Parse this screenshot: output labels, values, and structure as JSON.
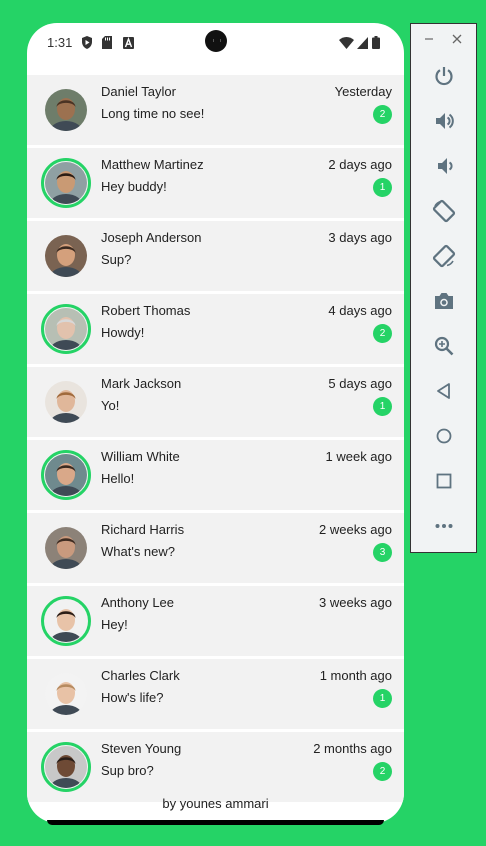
{
  "status_bar": {
    "time": "1:31"
  },
  "chats": [
    {
      "name": "Daniel Taylor",
      "message": "Long time no see!",
      "time": "Yesterday",
      "unread": "2",
      "online": false,
      "skin": "#9c7150",
      "hair": "#4a3324",
      "bg": "#6e7d6a"
    },
    {
      "name": "Matthew Martinez",
      "message": "Hey buddy!",
      "time": "2 days ago",
      "unread": "1",
      "online": true,
      "skin": "#c99a74",
      "hair": "#2c1d14",
      "bg": "#8fa0a3"
    },
    {
      "name": "Joseph Anderson",
      "message": "Sup?",
      "time": "3 days ago",
      "unread": "",
      "online": false,
      "skin": "#d4a07c",
      "hair": "#3b2a20",
      "bg": "#7a6352"
    },
    {
      "name": "Robert Thomas",
      "message": "Howdy!",
      "time": "4 days ago",
      "unread": "2",
      "online": true,
      "skin": "#e2c2ad",
      "hair": "#d8d8d8",
      "bg": "#b7bfb4"
    },
    {
      "name": "Mark Jackson",
      "message": "Yo!",
      "time": "5 days ago",
      "unread": "1",
      "online": false,
      "skin": "#e0b79a",
      "hair": "#a06a3c",
      "bg": "#e9e4de"
    },
    {
      "name": "William White",
      "message": "Hello!",
      "time": "1 week ago",
      "unread": "",
      "online": true,
      "skin": "#d9a889",
      "hair": "#3a2a20",
      "bg": "#6f8a8e"
    },
    {
      "name": "Richard Harris",
      "message": "What's new?",
      "time": "2 weeks ago",
      "unread": "3",
      "online": false,
      "skin": "#c99a7e",
      "hair": "#3e2c22",
      "bg": "#8c8278"
    },
    {
      "name": "Anthony Lee",
      "message": "Hey!",
      "time": "3 weeks ago",
      "unread": "",
      "online": true,
      "skin": "#e8c3a8",
      "hair": "#2b1e17",
      "bg": "#f1f1f1"
    },
    {
      "name": "Charles Clark",
      "message": "How's life?",
      "time": "1 month ago",
      "unread": "1",
      "online": false,
      "skin": "#e8c2a6",
      "hair": "#b68a5f",
      "bg": "#f3f3f3"
    },
    {
      "name": "Steven Young",
      "message": "Sup bro?",
      "time": "2 months ago",
      "unread": "2",
      "online": true,
      "skin": "#6e4a35",
      "hair": "#2a1e18",
      "bg": "#c8c8c8"
    }
  ],
  "footer": {
    "text": "by younes ammari"
  },
  "colors": {
    "accent": "#25d366",
    "row": "#f2f2f2"
  },
  "emulator_controls": [
    "power-icon",
    "volume-up-icon",
    "volume-down-icon",
    "rotate-left-icon",
    "rotate-right-icon",
    "camera-icon",
    "zoom-icon",
    "back-icon",
    "home-icon",
    "overview-icon",
    "more-icon"
  ]
}
